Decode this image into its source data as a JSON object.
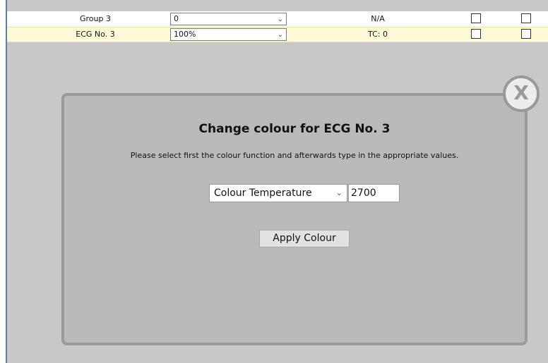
{
  "rows": [
    {
      "name": "Group 3",
      "value": "0",
      "info": "N/A"
    },
    {
      "name": "ECG No. 3",
      "value": "100%",
      "info": "TC: 0"
    }
  ],
  "dialog": {
    "close_label": "X",
    "title": "Change colour for ECG No. 3",
    "instruction": "Please select first the colour function and afterwards type in the appropriate values.",
    "function_selected": "Colour Temperature",
    "value": "2700",
    "apply_label": "Apply Colour"
  },
  "colors": {
    "background": "#c8c8c8",
    "dialog_background": "#bababa",
    "dialog_border": "#9a9a9a",
    "highlight_row": "#fffbd9",
    "frame_border": "#5e7ea8"
  },
  "icons": {
    "dropdown": "chevron-down-icon",
    "close": "close-icon"
  }
}
